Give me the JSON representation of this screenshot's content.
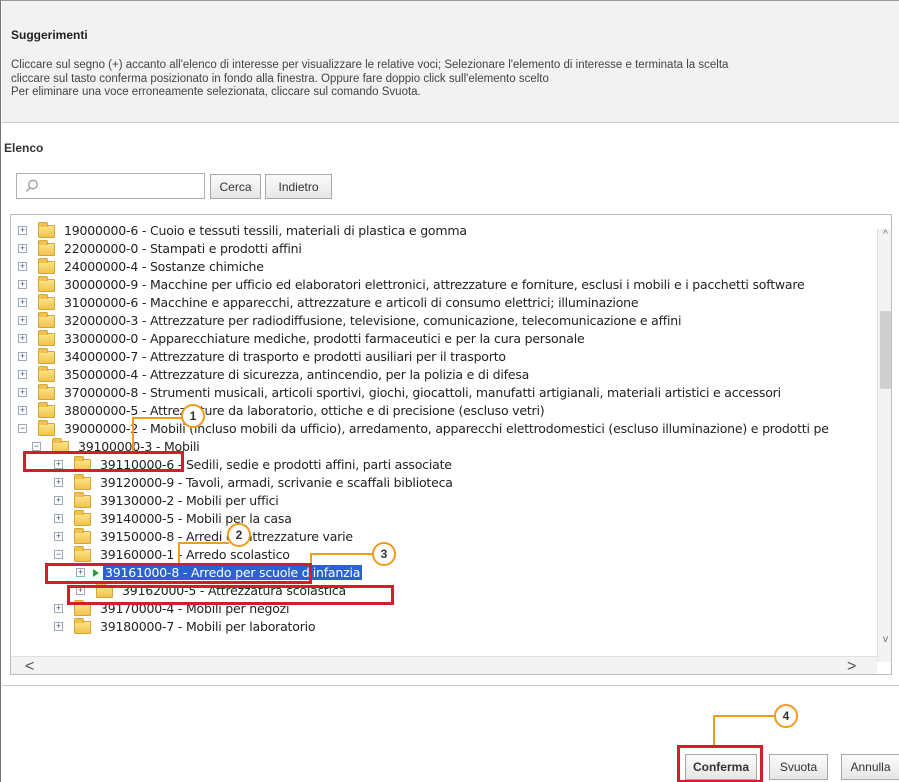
{
  "header": {
    "title": "Suggerimenti",
    "lines": [
      "Cliccare sul segno (+) accanto all'elenco di interesse per visualizzare le relative voci; Selezionare l'elemento di interesse e terminata la scelta",
      "cliccare sul tasto conferma posizionato in fondo alla finestra. Oppure fare doppio click sull'elemento scelto",
      "Per eliminare una voce erroneamente selezionata, cliccare sul comando Svuota."
    ]
  },
  "elenco": {
    "label": "Elenco",
    "search_placeholder": "",
    "search_button": "Cerca",
    "back_button": "Indietro"
  },
  "tree": {
    "rows": [
      {
        "text": "19000000-6 - Cuoio e tessuti tessili, materiali di plastica e gomma",
        "level": 0,
        "expander": "+"
      },
      {
        "text": "22000000-0 - Stampati e prodotti affini",
        "level": 0,
        "expander": "+"
      },
      {
        "text": "24000000-4 - Sostanze chimiche",
        "level": 0,
        "expander": "+"
      },
      {
        "text": "30000000-9 - Macchine per ufficio ed elaboratori elettronici, attrezzature e forniture, esclusi i mobili e i pacchetti software",
        "level": 0,
        "expander": "+"
      },
      {
        "text": "31000000-6 - Macchine e apparecchi, attrezzature e articoli di consumo elettrici; illuminazione",
        "level": 0,
        "expander": "+"
      },
      {
        "text": "32000000-3 - Attrezzature per radiodiffusione, televisione, comunicazione, telecomunicazione e affini",
        "level": 0,
        "expander": "+"
      },
      {
        "text": "33000000-0 - Apparecchiature mediche, prodotti farmaceutici e per la cura personale",
        "level": 0,
        "expander": "+"
      },
      {
        "text": "34000000-7 - Attrezzature di trasporto e prodotti ausiliari per il trasporto",
        "level": 0,
        "expander": "+"
      },
      {
        "text": "35000000-4 - Attrezzature di sicurezza, antincendio, per la polizia e di difesa",
        "level": 0,
        "expander": "+"
      },
      {
        "text": "37000000-8 - Strumenti musicali, articoli sportivi, giochi, giocattoli, manufatti artigianali, materiali artistici e accessori",
        "level": 0,
        "expander": "+"
      },
      {
        "text": "38000000-5 - Attrezzature da laboratorio, ottiche e di precisione (escluso vetri)",
        "level": 0,
        "expander": "+"
      },
      {
        "text": "39000000-2 - Mobili (incluso mobili da ufficio), arredamento, apparecchi elettrodomestici (escluso illuminazione) e prodotti pe",
        "level": 0,
        "expander": "-"
      },
      {
        "text": "39100000-3 - Mobili",
        "level": 1,
        "expander": "-"
      },
      {
        "text": "39110000-6 - Sedili, sedie e prodotti affini, parti associate",
        "level": 2,
        "expander": "+"
      },
      {
        "text": "39120000-9 - Tavoli, armadi, scrivanie e scaffali biblioteca",
        "level": 2,
        "expander": "+"
      },
      {
        "text": "39130000-2 - Mobili per uffici",
        "level": 2,
        "expander": "+"
      },
      {
        "text": "39140000-5 - Mobili per la casa",
        "level": 2,
        "expander": "+"
      },
      {
        "text": "39150000-8 - Arredi ed attrezzature varie",
        "level": 2,
        "expander": "+"
      },
      {
        "text": "39160000-1 - Arredo scolastico",
        "level": 2,
        "expander": "-"
      },
      {
        "text": "39161000-8 - Arredo per scuole d'infanzia",
        "level": 3,
        "expander": "+",
        "selected": true
      },
      {
        "text": "39162000-5 - Attrezzatura scolastica",
        "level": 3,
        "expander": "+"
      },
      {
        "text": "39170000-4 - Mobili per negozi",
        "level": 2,
        "expander": "+"
      },
      {
        "text": "39180000-7 - Mobili per laboratorio",
        "level": 2,
        "expander": "+"
      }
    ]
  },
  "footer": {
    "confirm_button": "Conferma",
    "clear_button": "Svuota",
    "cancel_button": "Annulla"
  },
  "callouts": [
    "1",
    "2",
    "3",
    "4"
  ],
  "colors": {
    "callout_border": "#d01f2b",
    "callout_accent": "#f29a1a",
    "selection": "#2b62d1"
  }
}
